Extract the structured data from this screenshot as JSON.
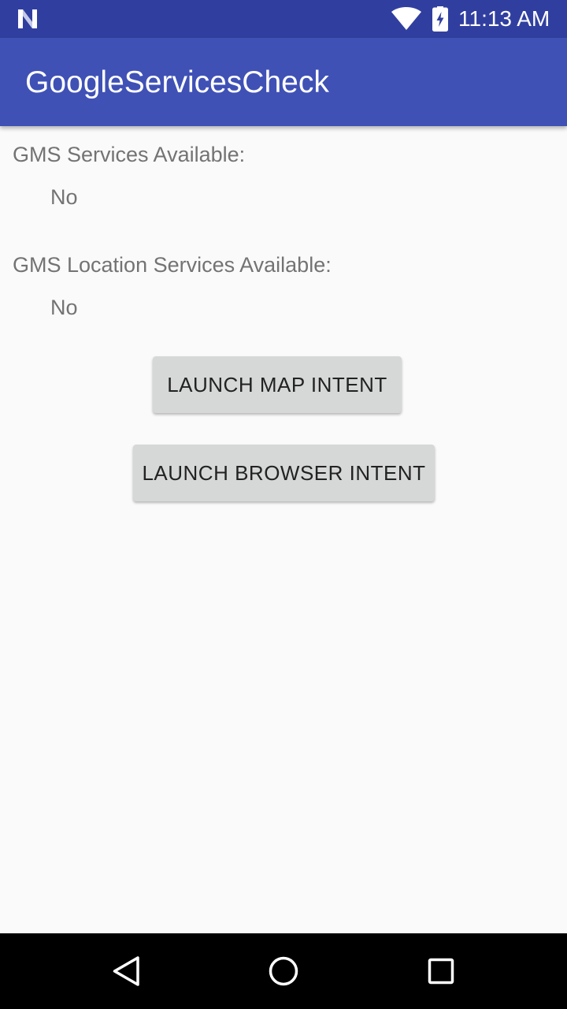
{
  "status_bar": {
    "time": "11:13 AM",
    "icons": [
      "notification-n-icon",
      "wifi-icon",
      "battery-charging-icon"
    ]
  },
  "app_bar": {
    "title": "GoogleServicesCheck"
  },
  "content": {
    "gms_services_label": "GMS Services Available:",
    "gms_services_value": "No",
    "gms_location_label": "GMS Location Services Available:",
    "gms_location_value": "No",
    "map_button_label": "LAUNCH MAP INTENT",
    "browser_button_label": "LAUNCH BROWSER INTENT"
  },
  "nav_bar": {
    "icons": [
      "back-icon",
      "home-icon",
      "recents-icon"
    ]
  },
  "colors": {
    "status_bar": "#303f9f",
    "app_bar": "#3f51b5",
    "background": "#fafafa",
    "text_secondary": "#737373",
    "button_bg": "#d6d7d7",
    "nav_bar": "#000000"
  }
}
